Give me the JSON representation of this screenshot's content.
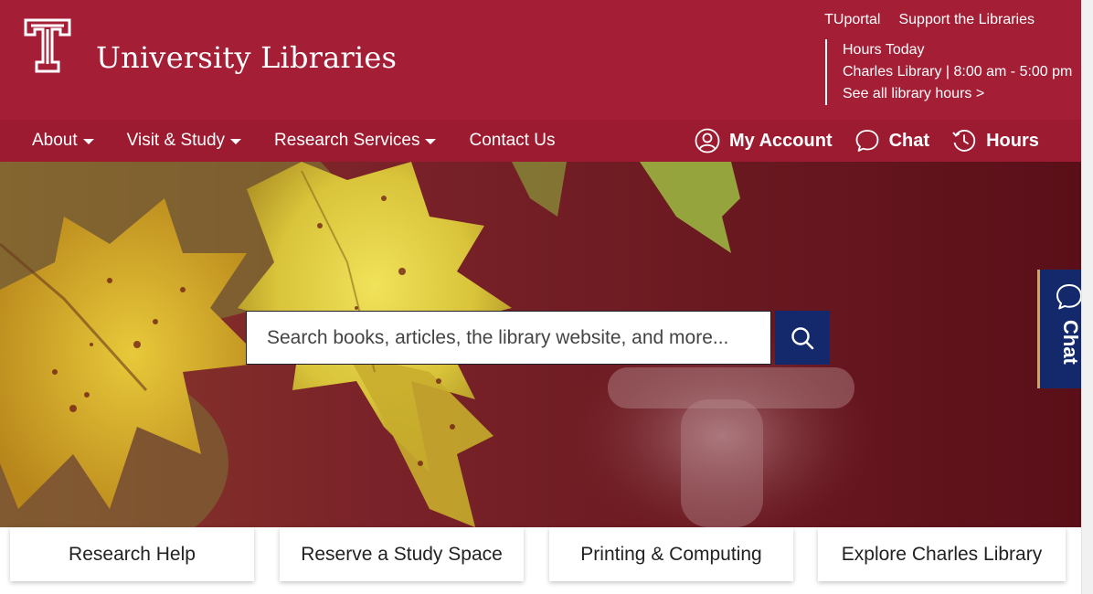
{
  "header": {
    "site_title": "University Libraries",
    "top_links": [
      "TUportal",
      "Support the Libraries"
    ],
    "hours": {
      "heading": "Hours Today",
      "today": "Charles Library | 8:00 am - 5:00 pm",
      "all_link": "See all library hours >"
    }
  },
  "nav": {
    "items": [
      {
        "label": "About",
        "dropdown": true
      },
      {
        "label": "Visit & Study",
        "dropdown": true
      },
      {
        "label": "Research Services",
        "dropdown": true
      },
      {
        "label": "Contact Us",
        "dropdown": false
      }
    ],
    "utilities": [
      {
        "label": "My Account",
        "icon": "user-circle-icon"
      },
      {
        "label": "Chat",
        "icon": "chat-bubble-icon"
      },
      {
        "label": "Hours",
        "icon": "clock-history-icon"
      }
    ]
  },
  "search": {
    "placeholder": "Search books, articles, the library website, and more...",
    "button_icon": "search-icon"
  },
  "chat_tab": {
    "label": "Chat",
    "icon": "chat-bubble-icon"
  },
  "cards": [
    "Research Help",
    "Reserve a Study Space",
    "Printing & Computing",
    "Explore Charles Library"
  ],
  "colors": {
    "brand_cherry": "#a41e35",
    "nav_cherry": "#9d1b30",
    "navy": "#13296c",
    "gold_accent": "#c9a66b"
  }
}
